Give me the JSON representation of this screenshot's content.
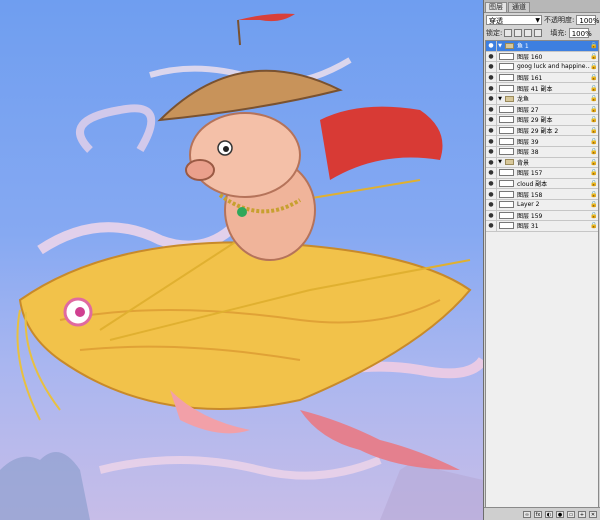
{
  "tabs": [
    {
      "label": "图层"
    },
    {
      "label": "通道"
    }
  ],
  "blend_mode": "穿透",
  "opacity": {
    "label": "不透明度:",
    "value": "100%"
  },
  "lock": {
    "label": "锁定:"
  },
  "fill": {
    "label": "填充:",
    "value": "100%"
  },
  "layers": [
    {
      "name": "鱼 1",
      "type": "group",
      "selected": true
    },
    {
      "name": "图层 160"
    },
    {
      "name": "goog luck and happine...",
      "type": "text"
    },
    {
      "name": "图层 161"
    },
    {
      "name": "图层 41 副本"
    },
    {
      "name": "龙鱼",
      "type": "group"
    },
    {
      "name": "图层 27"
    },
    {
      "name": "图层 29 副本"
    },
    {
      "name": "图层 29 副本 2"
    },
    {
      "name": "图层 39"
    },
    {
      "name": "图层 38"
    },
    {
      "name": "背景",
      "type": "group"
    },
    {
      "name": "图层 157"
    },
    {
      "name": "cloud 副本"
    },
    {
      "name": "图层 158"
    },
    {
      "name": "Layer 2"
    },
    {
      "name": "图层 159"
    },
    {
      "name": "图层 31"
    }
  ],
  "colors": {
    "selection": "#3d7fe0",
    "sky": "#7fa6e8",
    "fish": "#f2c24a",
    "pig": "#f0b49a",
    "hat": "#c8935a"
  }
}
